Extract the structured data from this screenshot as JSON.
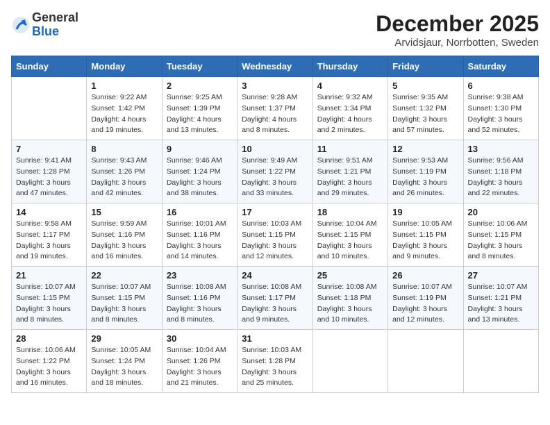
{
  "logo": {
    "general": "General",
    "blue": "Blue"
  },
  "title": "December 2025",
  "location": "Arvidsjaur, Norrbotten, Sweden",
  "days_of_week": [
    "Sunday",
    "Monday",
    "Tuesday",
    "Wednesday",
    "Thursday",
    "Friday",
    "Saturday"
  ],
  "weeks": [
    [
      {
        "day": "",
        "info": ""
      },
      {
        "day": "1",
        "info": "Sunrise: 9:22 AM\nSunset: 1:42 PM\nDaylight: 4 hours\nand 19 minutes."
      },
      {
        "day": "2",
        "info": "Sunrise: 9:25 AM\nSunset: 1:39 PM\nDaylight: 4 hours\nand 13 minutes."
      },
      {
        "day": "3",
        "info": "Sunrise: 9:28 AM\nSunset: 1:37 PM\nDaylight: 4 hours\nand 8 minutes."
      },
      {
        "day": "4",
        "info": "Sunrise: 9:32 AM\nSunset: 1:34 PM\nDaylight: 4 hours\nand 2 minutes."
      },
      {
        "day": "5",
        "info": "Sunrise: 9:35 AM\nSunset: 1:32 PM\nDaylight: 3 hours\nand 57 minutes."
      },
      {
        "day": "6",
        "info": "Sunrise: 9:38 AM\nSunset: 1:30 PM\nDaylight: 3 hours\nand 52 minutes."
      }
    ],
    [
      {
        "day": "7",
        "info": "Sunrise: 9:41 AM\nSunset: 1:28 PM\nDaylight: 3 hours\nand 47 minutes."
      },
      {
        "day": "8",
        "info": "Sunrise: 9:43 AM\nSunset: 1:26 PM\nDaylight: 3 hours\nand 42 minutes."
      },
      {
        "day": "9",
        "info": "Sunrise: 9:46 AM\nSunset: 1:24 PM\nDaylight: 3 hours\nand 38 minutes."
      },
      {
        "day": "10",
        "info": "Sunrise: 9:49 AM\nSunset: 1:22 PM\nDaylight: 3 hours\nand 33 minutes."
      },
      {
        "day": "11",
        "info": "Sunrise: 9:51 AM\nSunset: 1:21 PM\nDaylight: 3 hours\nand 29 minutes."
      },
      {
        "day": "12",
        "info": "Sunrise: 9:53 AM\nSunset: 1:19 PM\nDaylight: 3 hours\nand 26 minutes."
      },
      {
        "day": "13",
        "info": "Sunrise: 9:56 AM\nSunset: 1:18 PM\nDaylight: 3 hours\nand 22 minutes."
      }
    ],
    [
      {
        "day": "14",
        "info": "Sunrise: 9:58 AM\nSunset: 1:17 PM\nDaylight: 3 hours\nand 19 minutes."
      },
      {
        "day": "15",
        "info": "Sunrise: 9:59 AM\nSunset: 1:16 PM\nDaylight: 3 hours\nand 16 minutes."
      },
      {
        "day": "16",
        "info": "Sunrise: 10:01 AM\nSunset: 1:16 PM\nDaylight: 3 hours\nand 14 minutes."
      },
      {
        "day": "17",
        "info": "Sunrise: 10:03 AM\nSunset: 1:15 PM\nDaylight: 3 hours\nand 12 minutes."
      },
      {
        "day": "18",
        "info": "Sunrise: 10:04 AM\nSunset: 1:15 PM\nDaylight: 3 hours\nand 10 minutes."
      },
      {
        "day": "19",
        "info": "Sunrise: 10:05 AM\nSunset: 1:15 PM\nDaylight: 3 hours\nand 9 minutes."
      },
      {
        "day": "20",
        "info": "Sunrise: 10:06 AM\nSunset: 1:15 PM\nDaylight: 3 hours\nand 8 minutes."
      }
    ],
    [
      {
        "day": "21",
        "info": "Sunrise: 10:07 AM\nSunset: 1:15 PM\nDaylight: 3 hours\nand 8 minutes."
      },
      {
        "day": "22",
        "info": "Sunrise: 10:07 AM\nSunset: 1:15 PM\nDaylight: 3 hours\nand 8 minutes."
      },
      {
        "day": "23",
        "info": "Sunrise: 10:08 AM\nSunset: 1:16 PM\nDaylight: 3 hours\nand 8 minutes."
      },
      {
        "day": "24",
        "info": "Sunrise: 10:08 AM\nSunset: 1:17 PM\nDaylight: 3 hours\nand 9 minutes."
      },
      {
        "day": "25",
        "info": "Sunrise: 10:08 AM\nSunset: 1:18 PM\nDaylight: 3 hours\nand 10 minutes."
      },
      {
        "day": "26",
        "info": "Sunrise: 10:07 AM\nSunset: 1:19 PM\nDaylight: 3 hours\nand 12 minutes."
      },
      {
        "day": "27",
        "info": "Sunrise: 10:07 AM\nSunset: 1:21 PM\nDaylight: 3 hours\nand 13 minutes."
      }
    ],
    [
      {
        "day": "28",
        "info": "Sunrise: 10:06 AM\nSunset: 1:22 PM\nDaylight: 3 hours\nand 16 minutes."
      },
      {
        "day": "29",
        "info": "Sunrise: 10:05 AM\nSunset: 1:24 PM\nDaylight: 3 hours\nand 18 minutes."
      },
      {
        "day": "30",
        "info": "Sunrise: 10:04 AM\nSunset: 1:26 PM\nDaylight: 3 hours\nand 21 minutes."
      },
      {
        "day": "31",
        "info": "Sunrise: 10:03 AM\nSunset: 1:28 PM\nDaylight: 3 hours\nand 25 minutes."
      },
      {
        "day": "",
        "info": ""
      },
      {
        "day": "",
        "info": ""
      },
      {
        "day": "",
        "info": ""
      }
    ]
  ]
}
